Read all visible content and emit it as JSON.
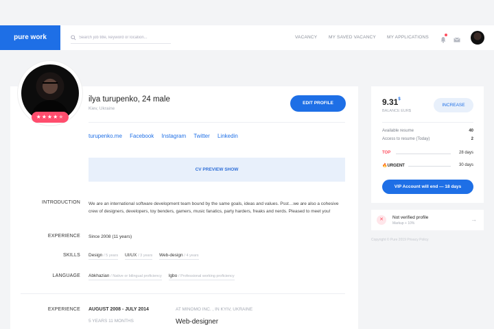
{
  "header": {
    "logo": "pure work",
    "search_placeholder": "Search job title, keyword or location...",
    "nav": [
      "VACANCY",
      "MY SAVED VACANCY",
      "MY APPLICATIONS"
    ],
    "notification_dot_color": "#ff4d5e",
    "icons": [
      "search-icon",
      "bell-icon",
      "mail-icon"
    ]
  },
  "profile": {
    "name": "ilya turupenko, 24 male",
    "location": "Kiev, Ukraine",
    "edit_label": "EDIT PROFILE",
    "rating": 4,
    "rating_max": 5,
    "links": [
      "turupenko.me",
      "Facebook",
      "Instagram",
      "Twitter",
      "Linkedin"
    ],
    "cv_preview_label": "CV PREVIEW SHOW",
    "introduction_label": "INTRODUCTION",
    "introduction_text": "We are an international software development team bound by the same goals, ideas and values. Psst…we are also a cohesive crew of designers, developers, toy benders, gamers, music fanatics, party harders, freaks and nerds. Pleased to meet you!",
    "experience_label": "EXPERIENCE",
    "experience_value": "Since 2008 (11 years)",
    "skills_label": "SKILLS",
    "skills": [
      {
        "name": "Design",
        "level": "/ 5 years"
      },
      {
        "name": "UI/UX",
        "level": "/ 3 years"
      },
      {
        "name": "Web-design",
        "level": "/ 4 years"
      }
    ],
    "language_label": "LANGUAGE",
    "languages": [
      {
        "name": "Abkhazian",
        "level": "/ Native or bilingual proficiency"
      },
      {
        "name": "Igbo",
        "level": "/ Professional working proficiency"
      }
    ],
    "work": {
      "label": "EXPERIENCE",
      "dates": "AUGUST 2008 - JULY 2014",
      "duration": "5 YEARS 11 MONTHS",
      "company": "AT MINOMO INC. , IN KYIV, UKRAINE",
      "role": "Web-designer"
    }
  },
  "side": {
    "balance": "9.31",
    "balance_currency": "$",
    "balance_label": "BALANCE EUR$",
    "increase_label": "INCREASE",
    "available_label": "Available resume",
    "available_value": "40",
    "access_label": "Access to resume (Today)",
    "access_value": "2",
    "top_label": "TOP",
    "top_value": "28 days",
    "urgent_label": "URGENT",
    "urgent_value": "30 days",
    "vip_label": "VIP Account will end — 18 days"
  },
  "notice": {
    "title": "Not verified profile",
    "sub": "Markup + 10%"
  },
  "footer": {
    "copyright": "Copyright © Pure 2019    Privacy Policy"
  },
  "colors": {
    "accent": "#1e6fe6",
    "danger": "#ff4d5e",
    "rating": "#ff4d6d"
  }
}
